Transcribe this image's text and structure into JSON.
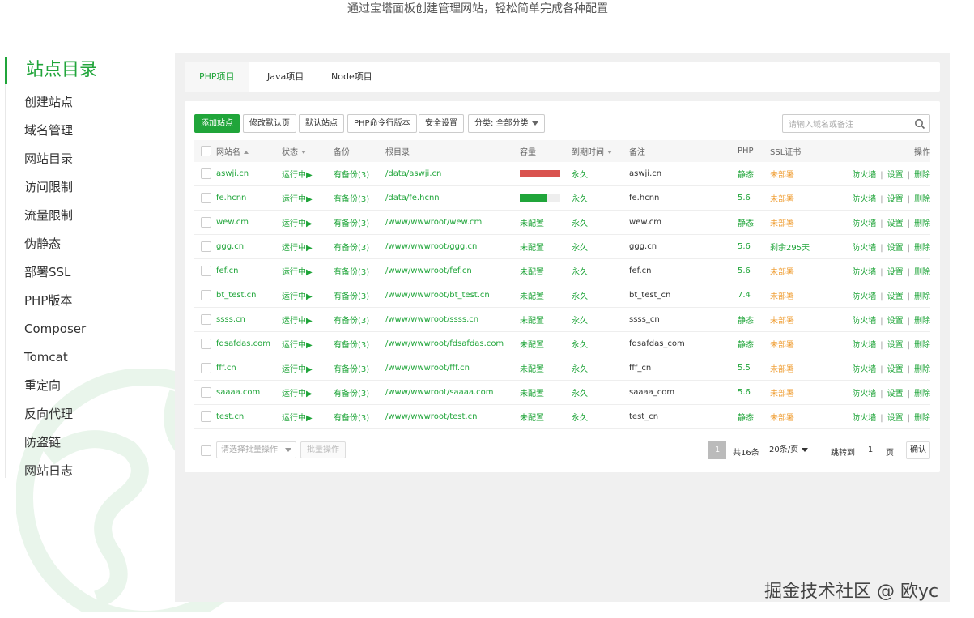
{
  "subtitle": "通过宝塔面板创建管理网站，轻松简单完成各种配置",
  "sidebar": {
    "title": "站点目录",
    "items": [
      "创建站点",
      "域名管理",
      "网站目录",
      "访问限制",
      "流量限制",
      "伪静态",
      "部署SSL",
      "PHP版本",
      "Composer",
      "Tomcat",
      "重定向",
      "反向代理",
      "防盗链",
      "网站日志"
    ]
  },
  "tabs": [
    "PHP项目",
    "Java项目",
    "Node项目"
  ],
  "toolbar": {
    "add_site": "添加站点",
    "edit_default_page": "修改默认页",
    "default_site": "默认站点",
    "php_cli_version": "PHP命令行版本",
    "security": "安全设置",
    "category": "分类: 全部分类",
    "search_placeholder": "请输入域名或备注"
  },
  "table": {
    "headers": [
      "网站名",
      "状态",
      "备份",
      "根目录",
      "容量",
      "到期时间",
      "备注",
      "PHP",
      "SSL证书",
      "操作"
    ],
    "ops": {
      "firewall": "防火墙",
      "settings": "设置",
      "delete": "删除",
      "sep": "|"
    },
    "rows": [
      {
        "name": "aswji.cn",
        "status": "运行中▶",
        "backup": "有备份(3)",
        "root": "/data/aswji.cn",
        "capacity": {
          "type": "bar",
          "fill": 1.0,
          "color": "#d9534f"
        },
        "expire": "永久",
        "note": "aswji.cn",
        "php": "静态",
        "ssl": "未部署",
        "ssl_color": "#f0a13a"
      },
      {
        "name": "fe.hcnn",
        "status": "运行中▶",
        "backup": "有备份(3)",
        "root": "/data/fe.hcnn",
        "capacity": {
          "type": "bar",
          "fill": 0.68,
          "color": "#20a53a"
        },
        "expire": "永久",
        "note": "fe.hcnn",
        "php": "5.6",
        "ssl": "未部署",
        "ssl_color": "#f0a13a"
      },
      {
        "name": "wew.cm",
        "status": "运行中▶",
        "backup": "有备份(3)",
        "root": "/www/wwwroot/wew.cm",
        "capacity": {
          "type": "text",
          "text": "未配置"
        },
        "expire": "永久",
        "note": "wew.cm",
        "php": "静态",
        "ssl": "未部署",
        "ssl_color": "#f0a13a"
      },
      {
        "name": "ggg.cn",
        "status": "运行中▶",
        "backup": "有备份(3)",
        "root": "/www/wwwroot/ggg.cn",
        "capacity": {
          "type": "text",
          "text": "未配置"
        },
        "expire": "永久",
        "note": "ggg.cn",
        "php": "5.6",
        "ssl": "剩余295天",
        "ssl_color": "#20a53a"
      },
      {
        "name": "fef.cn",
        "status": "运行中▶",
        "backup": "有备份(3)",
        "root": "/www/wwwroot/fef.cn",
        "capacity": {
          "type": "text",
          "text": "未配置"
        },
        "expire": "永久",
        "note": "fef.cn",
        "php": "5.6",
        "ssl": "未部署",
        "ssl_color": "#f0a13a"
      },
      {
        "name": "bt_test.cn",
        "status": "运行中▶",
        "backup": "有备份(3)",
        "root": "/www/wwwroot/bt_test.cn",
        "capacity": {
          "type": "text",
          "text": "未配置"
        },
        "expire": "永久",
        "note": "bt_test_cn",
        "php": "7.4",
        "ssl": "未部署",
        "ssl_color": "#f0a13a"
      },
      {
        "name": "ssss.cn",
        "status": "运行中▶",
        "backup": "有备份(3)",
        "root": "/www/wwwroot/ssss.cn",
        "capacity": {
          "type": "text",
          "text": "未配置"
        },
        "expire": "永久",
        "note": "ssss_cn",
        "php": "静态",
        "ssl": "未部署",
        "ssl_color": "#f0a13a"
      },
      {
        "name": "fdsafdas.com",
        "status": "运行中▶",
        "backup": "有备份(3)",
        "root": "/www/wwwroot/fdsafdas.com",
        "capacity": {
          "type": "text",
          "text": "未配置"
        },
        "expire": "永久",
        "note": "fdsafdas_com",
        "php": "静态",
        "ssl": "未部署",
        "ssl_color": "#f0a13a"
      },
      {
        "name": "fff.cn",
        "status": "运行中▶",
        "backup": "有备份(3)",
        "root": "/www/wwwroot/fff.cn",
        "capacity": {
          "type": "text",
          "text": "未配置"
        },
        "expire": "永久",
        "note": "fff_cn",
        "php": "5.5",
        "ssl": "未部署",
        "ssl_color": "#f0a13a"
      },
      {
        "name": "saaaa.com",
        "status": "运行中▶",
        "backup": "有备份(3)",
        "root": "/www/wwwroot/saaaa.com",
        "capacity": {
          "type": "text",
          "text": "未配置"
        },
        "expire": "永久",
        "note": "saaaa_com",
        "php": "5.6",
        "ssl": "未部署",
        "ssl_color": "#f0a13a"
      },
      {
        "name": "test.cn",
        "status": "运行中▶",
        "backup": "有备份(3)",
        "root": "/www/wwwroot/test.cn",
        "capacity": {
          "type": "text",
          "text": "未配置"
        },
        "expire": "永久",
        "note": "test_cn",
        "php": "静态",
        "ssl": "未部署",
        "ssl_color": "#f0a13a"
      }
    ]
  },
  "footer": {
    "batch_placeholder": "请选择批量操作",
    "batch_button": "批量操作",
    "page": "1",
    "total": "共16条",
    "per_page": "20条/页",
    "jump_label": "跳转到",
    "jump_value": "1",
    "page_unit": "页",
    "confirm": "确认"
  },
  "watermark": "掘金技术社区 @ 欧yc",
  "colors": {
    "accent": "#20a53a",
    "warning": "#f0a13a",
    "danger": "#d9534f"
  },
  "icons": {
    "search": "search-icon",
    "globe": "globe-icon",
    "sort": "sort-arrow-icon",
    "dropdown": "chevron-down-icon"
  }
}
